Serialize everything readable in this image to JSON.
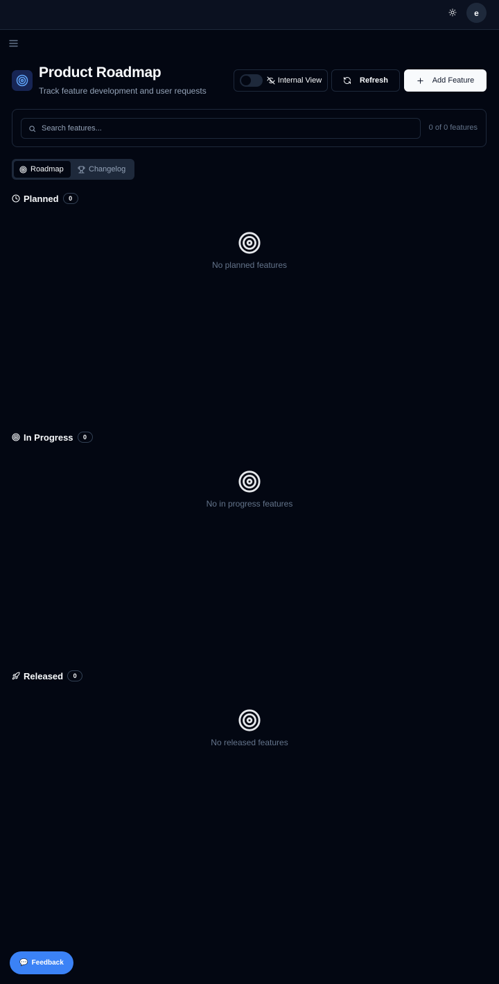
{
  "topbar": {
    "theme_icon": "sun-icon",
    "avatar_letter": "e"
  },
  "sidebar": {
    "menu_icon": "menu-icon"
  },
  "header": {
    "logo_icon": "target-icon",
    "title": "Product Roadmap",
    "subtitle": "Track feature development and user requests",
    "internal_view_label": "Internal View",
    "internal_view_on": false,
    "refresh_label": "Refresh",
    "add_feature_label": "Add Feature"
  },
  "search": {
    "placeholder": "Search features...",
    "value": "",
    "count_text": "0 of 0 features"
  },
  "tabs": [
    {
      "label": "Roadmap",
      "icon": "target-icon",
      "active": true
    },
    {
      "label": "Changelog",
      "icon": "trophy-icon",
      "active": false
    }
  ],
  "sections": [
    {
      "title": "Planned",
      "icon": "clock-icon",
      "count": "0",
      "empty_text": "No planned features"
    },
    {
      "title": "In Progress",
      "icon": "target-icon",
      "count": "0",
      "empty_text": "No in progress features"
    },
    {
      "title": "Released",
      "icon": "rocket-icon",
      "count": "0",
      "empty_text": "No released features"
    }
  ],
  "feedback": {
    "label": "Feedback",
    "icon": "speech-bubble-icon"
  },
  "colors": {
    "background": "#030712",
    "accent": "#3b82f6",
    "border": "#1e293b",
    "muted_text": "#94a3b8"
  }
}
